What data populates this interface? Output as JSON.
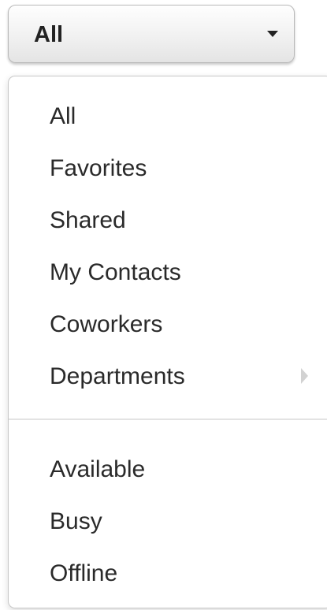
{
  "select": {
    "value": "All",
    "icon": "caret-down-icon"
  },
  "menu": {
    "items": [
      {
        "label": "All"
      },
      {
        "label": "Favorites"
      },
      {
        "label": "Shared"
      },
      {
        "label": "My Contacts"
      },
      {
        "label": "Coworkers"
      },
      {
        "label": "Departments",
        "has_submenu": true,
        "submenu_icon": "chevron-right-icon"
      }
    ],
    "status_items": [
      {
        "label": "Available"
      },
      {
        "label": "Busy"
      },
      {
        "label": "Offline"
      }
    ]
  },
  "colors": {
    "text": "#2a2a2a",
    "border": "#c8c8c8",
    "divider": "#e3e3e3",
    "submenu_arrow": "#d2d2d2"
  }
}
